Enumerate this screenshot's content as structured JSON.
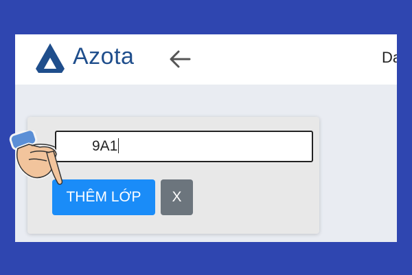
{
  "header": {
    "brand": "Azota",
    "edge_text": "Da"
  },
  "form": {
    "class_input_value": "9A1",
    "add_button_label": "THÊM LỚP",
    "close_button_label": "X"
  },
  "colors": {
    "outer_background": "#2f46b0",
    "brand": "#1f4e8c",
    "primary_button": "#1a8cf8",
    "secondary_button": "#6c757d"
  },
  "icons": [
    "azota-logo-icon",
    "back-arrow-icon",
    "pointing-hand-icon"
  ]
}
